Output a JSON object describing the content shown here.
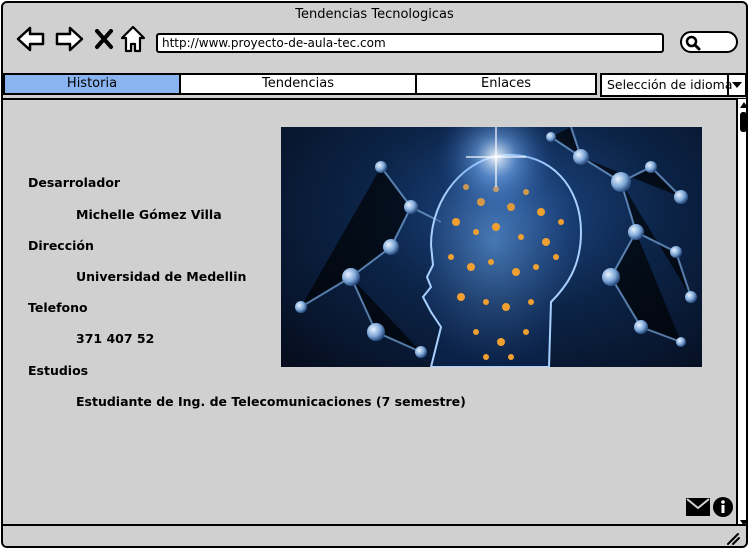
{
  "window": {
    "title": "Tendencias Tecnologicas"
  },
  "browser": {
    "back_icon": "arrow-left-icon",
    "forward_icon": "arrow-right-icon",
    "stop_icon": "close-icon",
    "home_icon": "home-icon",
    "url": "http://www.proyecto-de-aula-tec.com",
    "search_icon": "search-icon"
  },
  "tabs": [
    {
      "label": "Historia",
      "active": true
    },
    {
      "label": "Tendencias",
      "active": false
    },
    {
      "label": "Enlaces",
      "active": false
    }
  ],
  "language_select": {
    "value": "Selección de idioma"
  },
  "info": [
    {
      "label": "Desarrolador",
      "value": "Michelle Gómez Villa"
    },
    {
      "label": "Dirección",
      "value": "Universidad de Medellin"
    },
    {
      "label": "Telefono",
      "value": "371 407 52"
    },
    {
      "label": "Estudios",
      "value": "Estudiante de Ing. de Telecomunicaciones (7 semestre)"
    }
  ],
  "footer_icons": [
    "mail-icon",
    "info-icon"
  ],
  "colors": {
    "window_bg": "#d0d0d0",
    "active_tab": "#8ab4f0",
    "hero_bg": "#0c2448"
  }
}
